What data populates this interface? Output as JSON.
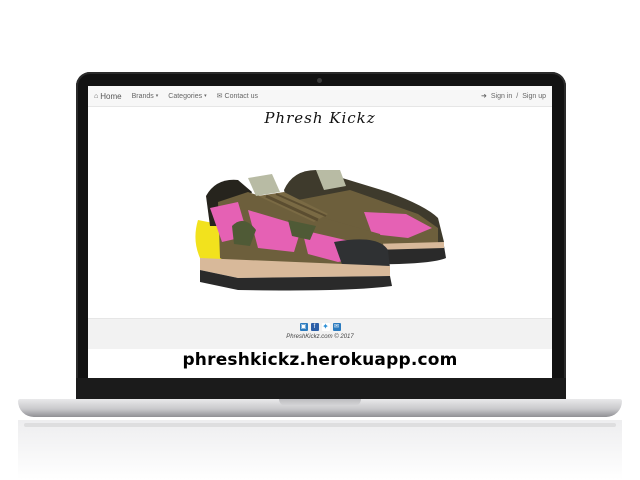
{
  "navbar": {
    "home_label": "Home",
    "items": [
      {
        "label": "Brands"
      },
      {
        "label": "Categories"
      },
      {
        "label": "Contact us"
      }
    ],
    "sign_in_label": "Sign in",
    "separator": "/",
    "sign_up_label": "Sign up"
  },
  "brand": {
    "title": "Phresh Kickz"
  },
  "product": {
    "alt": "pink and camo sneakers"
  },
  "footer": {
    "social_icons": [
      "instagram-icon",
      "facebook-icon",
      "twitter-icon",
      "email-icon"
    ],
    "copyright": "PhreshKickz.com © 2017"
  },
  "caption": {
    "url": "phreshkickz.herokuapp.com"
  },
  "colors": {
    "screen_bezel": "#121212",
    "laptop_base": "#c9c9cc",
    "shoe_pink": "#e561b4",
    "shoe_camo": "#6d5f3c",
    "shoe_yellow": "#f2e21d"
  }
}
